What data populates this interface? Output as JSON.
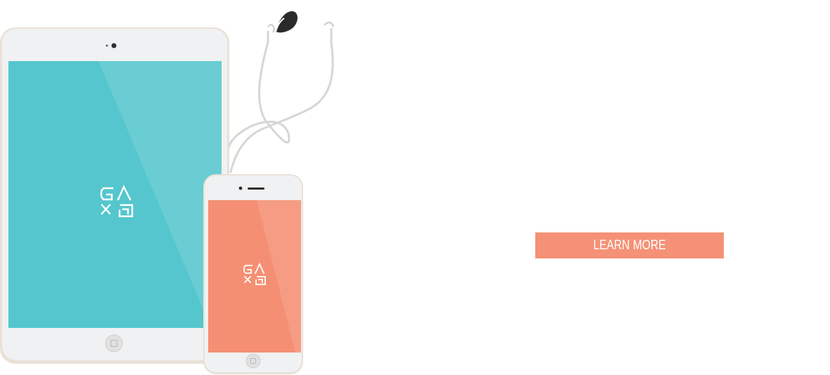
{
  "cta": {
    "label": "LEARN MORE"
  },
  "devices": {
    "tablet_screen_color": "#55c6cd",
    "phone_screen_color": "#f58f73",
    "bezel_color": "#f0f1f2",
    "frame_color": "#e9e1d8"
  },
  "icons": {
    "tablet_logo": "gamepad-logo-icon",
    "phone_logo": "gamepad-logo-icon",
    "earphones": "earphones-icon"
  }
}
